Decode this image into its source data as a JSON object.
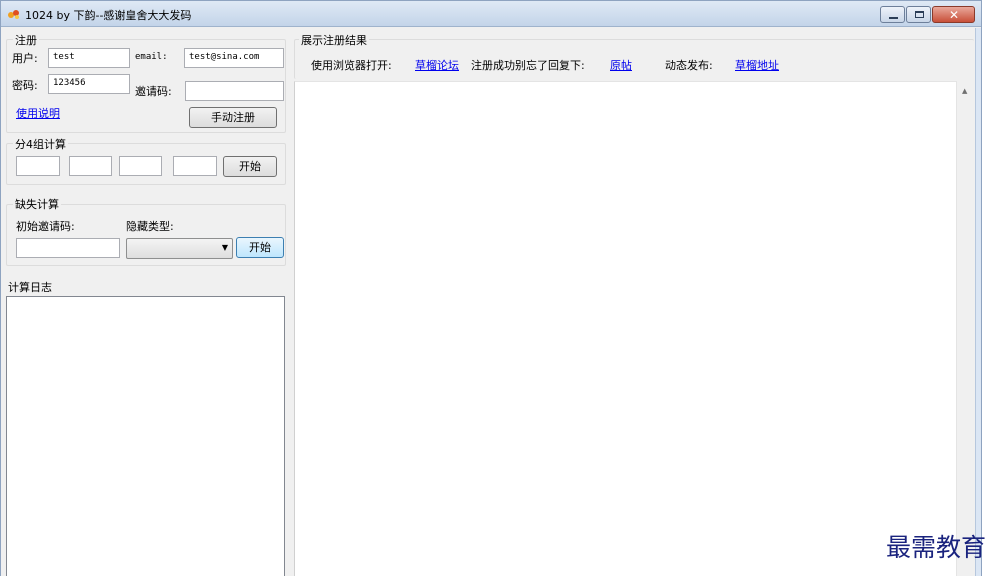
{
  "window": {
    "title": "1024 by 下韵--感谢皇舍大大发码"
  },
  "register": {
    "group_label": "注册",
    "user_label": "用户:",
    "user_value": "test",
    "email_label": "email:",
    "email_value": "test@sina.com",
    "password_label": "密码:",
    "password_value": "123456",
    "invite_label": "邀请码:",
    "invite_value": "",
    "help_link": "使用说明",
    "manual_register_button": "手动注册"
  },
  "split_calc": {
    "group_label": "分4组计算",
    "fields": [
      "",
      "",
      "",
      ""
    ],
    "start_button": "开始"
  },
  "missing_calc": {
    "group_label": "缺失计算",
    "initial_invite_label": "初始邀请码:",
    "hidden_type_label": "隐藏类型:",
    "initial_invite_value": "",
    "hidden_type_value": "",
    "start_button": "开始"
  },
  "log": {
    "group_label": "计算日志",
    "content": ""
  },
  "results": {
    "group_label": "展示注册结果",
    "open_with_label": "使用浏览器打开:",
    "forum_link": "草榴论坛",
    "reply_label": "注册成功别忘了回复下:",
    "original_post_link": "原帖",
    "dynamic_label": "动态发布:",
    "address_link": "草榴地址"
  },
  "watermark": "最需教育",
  "colors": {
    "link": "#0000ee",
    "title_bar": "#c3d4e9",
    "close_button": "#c84f38"
  }
}
